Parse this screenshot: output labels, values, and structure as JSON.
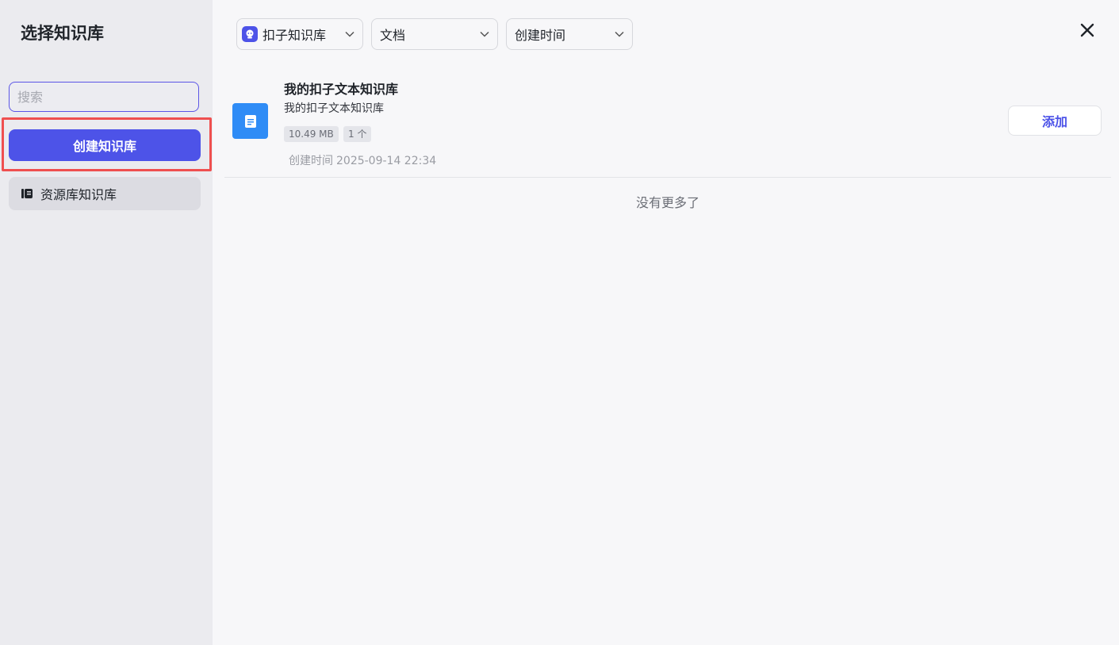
{
  "sidebar": {
    "title": "选择知识库",
    "search_placeholder": "搜索",
    "create_button": "创建知识库",
    "items": [
      {
        "label": "资源库知识库",
        "icon": "book-icon"
      }
    ]
  },
  "filters": {
    "source": {
      "label": "扣子知识库",
      "icon": "coze-logo-icon"
    },
    "type": {
      "label": "文档"
    },
    "sort": {
      "label": "创建时间"
    }
  },
  "close_icon": "close-icon",
  "list": [
    {
      "title": "我的扣子文本知识库",
      "description": "我的扣子文本知识库",
      "size": "10.49 MB",
      "count": "1 个",
      "created_label": "创建时间",
      "created_time": "2025-09-14 22:34",
      "add_label": "添加",
      "icon": "document-icon"
    }
  ],
  "footer_text": "没有更多了",
  "colors": {
    "accent": "#4d53e8",
    "highlight": "#ef4f4f",
    "doc_icon": "#2f8cf6"
  }
}
